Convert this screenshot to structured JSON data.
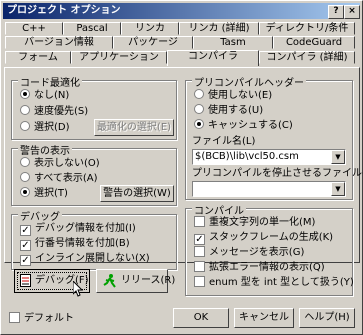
{
  "window": {
    "title": "プロジェクト オプション",
    "help_btn": "?",
    "close_btn": "×"
  },
  "tabs_row1": [
    "C++",
    "Pascal",
    "リンカ",
    "リンカ (詳細)",
    "ディレクトリ/条件"
  ],
  "tabs_row2": [
    "バージョン情報",
    "パッケージ",
    "Tasm",
    "CodeGuard"
  ],
  "tabs_row3": [
    "フォーム",
    "アプリケーション",
    "コンパイラ",
    "コンパイラ (詳細)"
  ],
  "code_opt": {
    "title": "コード最適化",
    "options": [
      "なし(N)",
      "速度優先(S)",
      "選択(D)"
    ],
    "select_btn": "最適化の選択(E)"
  },
  "warnings": {
    "title": "警告の表示",
    "options": [
      "表示しない(O)",
      "すべて表示(A)",
      "選択(T)"
    ],
    "select_btn": "警告の選択(W)"
  },
  "debug": {
    "title": "デバッグ",
    "options": [
      "デバッグ情報を付加(I)",
      "行番号情報を付加(B)",
      "インライン展開しない(X)"
    ]
  },
  "precompiled": {
    "title": "プリコンパイルヘッダー",
    "options": [
      "使用しない(E)",
      "使用する(U)",
      "キャッシュする(C)"
    ],
    "file_label": "ファイル名(L)",
    "file_value": "$(BCB)\\lib\\vcl50.csm",
    "stop_label": "プリコンパイルを停止させるファイル(F)",
    "stop_value": ""
  },
  "compile": {
    "title": "コンパイル",
    "options": [
      "重複文字列の単一化(M)",
      "スタックフレームの生成(K)",
      "メッセージを表示(G)",
      "拡張エラー情報の表示(Q)",
      "enum 型を int 型として扱う(Y)"
    ]
  },
  "actions": {
    "debug_btn": "デバッグ(F)",
    "release_btn": "リリース(R)"
  },
  "footer": {
    "default_label": "デフォルト",
    "ok": "OK",
    "cancel": "キャンセル",
    "help": "ヘルプ(H)"
  },
  "colors": {
    "face": "#d4d0c8",
    "title_start": "#0a246a",
    "title_end": "#a6caf0",
    "disabled_text": "#808080"
  }
}
